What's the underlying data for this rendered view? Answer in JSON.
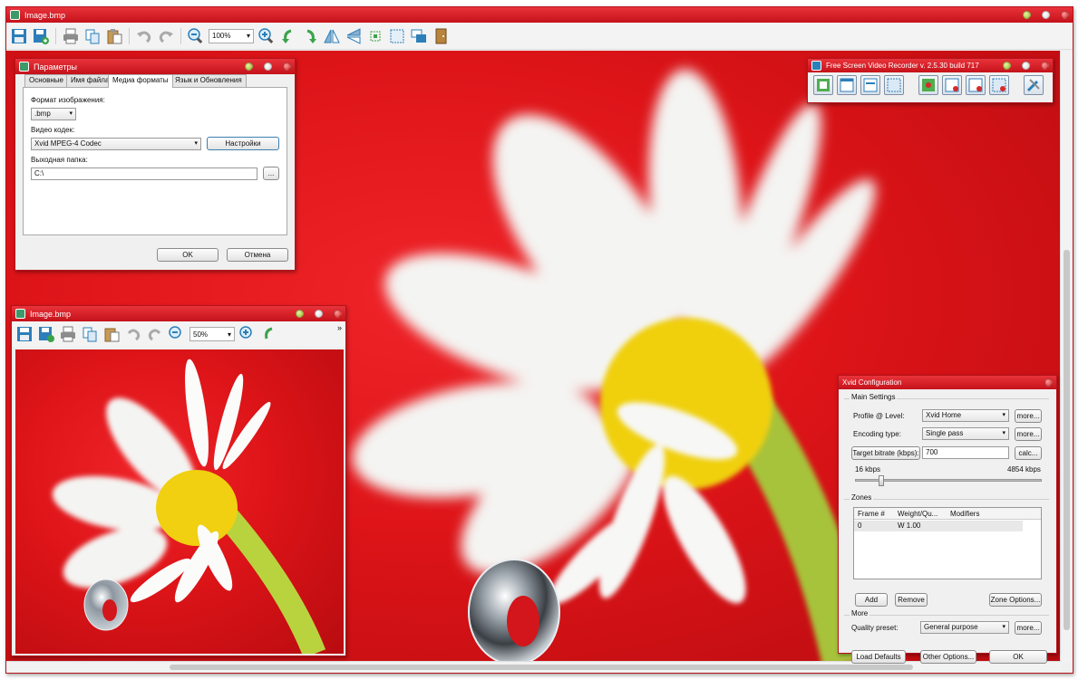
{
  "main_window": {
    "title": "Image.bmp",
    "zoom": "100%"
  },
  "params_dialog": {
    "title": "Параметры",
    "tabs": [
      "Основные",
      "Имя файла",
      "Медиа форматы",
      "Язык и Обновления"
    ],
    "image_format_label": "Формат изображения:",
    "image_format_value": ".bmp",
    "video_codec_label": "Видео кодек:",
    "video_codec_value": "Xvid MPEG-4 Codec",
    "settings_button": "Настройки",
    "output_folder_label": "Выходная папка:",
    "output_folder_value": "C:\\",
    "browse_button": "...",
    "ok_button": "OK",
    "cancel_button": "Отмена"
  },
  "small_window": {
    "title": "Image.bmp",
    "zoom": "50%",
    "overflow": "»"
  },
  "recorder": {
    "title": "Free Screen Video Recorder  v. 2.5.30 build 717"
  },
  "xvid": {
    "title": "Xvid Configuration",
    "main_settings": "Main Settings",
    "profile_label": "Profile @ Level:",
    "profile_value": "Xvid Home",
    "encoding_label": "Encoding type:",
    "encoding_value": "Single pass",
    "bitrate_label": "Target bitrate (kbps):",
    "bitrate_value": "700",
    "more1": "more...",
    "more2": "more...",
    "calc": "calc...",
    "min_kbps": "16 kbps",
    "max_kbps": "4854 kbps",
    "slider_fraction": 0.14,
    "zones": "Zones",
    "zone_columns": [
      "Frame #",
      "Weight/Qu...",
      "Modifiers"
    ],
    "zone_rows": [
      [
        "0",
        "W 1.00",
        ""
      ]
    ],
    "add": "Add",
    "remove": "Remove",
    "zone_options": "Zone Options...",
    "more_group": "More",
    "quality_label": "Quality preset:",
    "quality_value": "General purpose",
    "more3": "more...",
    "load_defaults": "Load Defaults",
    "other_options": "Other Options...",
    "ok": "OK"
  }
}
